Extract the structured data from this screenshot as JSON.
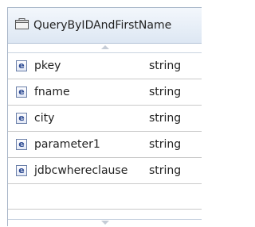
{
  "business_object": {
    "title": "QueryByIDAndFirstName",
    "title_icon": "business-object-icon",
    "fields": [
      {
        "icon": "element-icon",
        "icon_glyph": "e",
        "name": "pkey",
        "type": "string"
      },
      {
        "icon": "element-icon",
        "icon_glyph": "e",
        "name": "fname",
        "type": "string"
      },
      {
        "icon": "element-icon",
        "icon_glyph": "e",
        "name": "city",
        "type": "string"
      },
      {
        "icon": "element-icon",
        "icon_glyph": "e",
        "name": "parameter1",
        "type": "string"
      },
      {
        "icon": "element-icon",
        "icon_glyph": "e",
        "name": "jdbcwhereclause",
        "type": "string"
      }
    ]
  },
  "colors": {
    "title_bar_top": "#f3f7fc",
    "title_bar_bottom": "#dde7f3",
    "border": "#a9b7c9",
    "row_divider": "#c9c9c9",
    "icon_letter": "#2c4a92"
  }
}
